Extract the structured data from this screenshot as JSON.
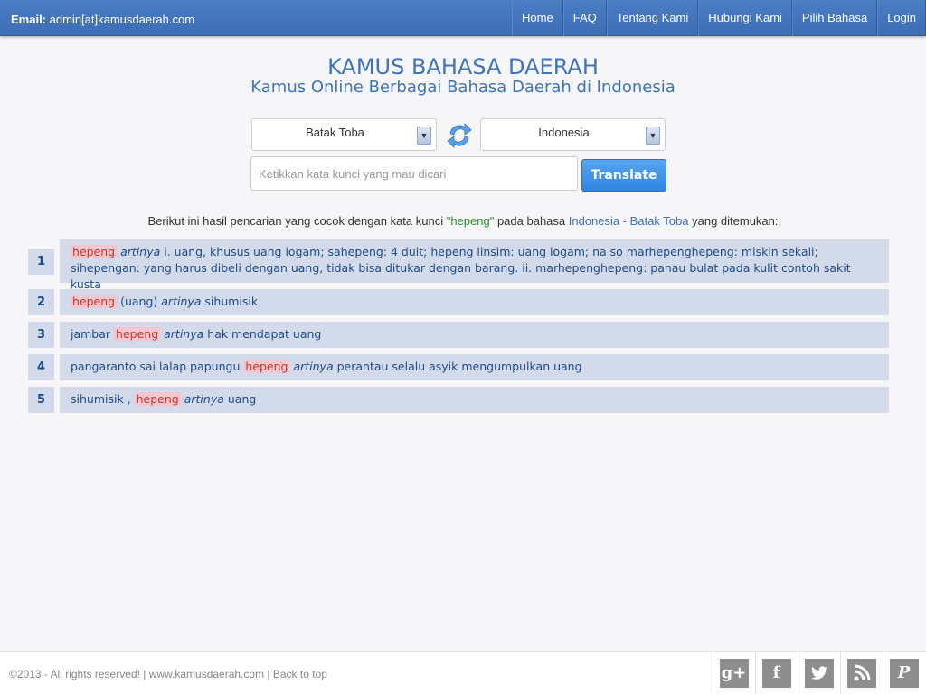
{
  "header": {
    "email_label": "Email:",
    "email_value": "admin[at]kamusdaerah.com",
    "nav": [
      {
        "label": "Home"
      },
      {
        "label": "FAQ"
      },
      {
        "label": "Tentang Kami"
      },
      {
        "label": "Hubungi Kami"
      },
      {
        "label": "Pilih Bahasa"
      },
      {
        "label": "Login"
      }
    ]
  },
  "main": {
    "title": "KAMUS BAHASA DAERAH",
    "subtitle": "Kamus Online Berbagai Bahasa Daerah di Indonesia",
    "from_language": "Batak Toba",
    "to_language": "Indonesia",
    "search_placeholder": "Ketikkan kata kunci yang mau dicari",
    "translate_label": "Translate",
    "intro": {
      "before": "Berikut ini hasil pencarian yang cocok dengan kata kunci ",
      "keyword": "\"hepeng\"",
      "middle": " pada bahasa ",
      "language_pair": "Indonesia - Batak Toba",
      "after": " yang ditemukan:"
    }
  },
  "results": [
    {
      "number": "1",
      "prefix": "",
      "keyword": "hepeng",
      "suffix": "",
      "artinya": "artinya",
      "meaning": "i. uang, khusus uang logam; sahepeng: 4 duit; hepeng linsim: uang logam; na so marhepenghepeng: miskin sekali; sihepengan: yang harus dibeli dengan uang, tidak bisa ditukar dengan barang. ii. marhepenghepeng: panau bulat pada kulit contoh sakit kusta"
    },
    {
      "number": "2",
      "prefix": "",
      "keyword": "hepeng",
      "suffix": " (uang)",
      "artinya": "artinya",
      "meaning": "sihumisik"
    },
    {
      "number": "3",
      "prefix": "jambar ",
      "keyword": "hepeng",
      "suffix": "",
      "artinya": "artinya",
      "meaning": "hak mendapat uang"
    },
    {
      "number": "4",
      "prefix": "pangaranto sai lalap papungu ",
      "keyword": "hepeng",
      "suffix": "",
      "artinya": "artinya",
      "meaning": "perantau selalu asyik mengumpulkan uang"
    },
    {
      "number": "5",
      "prefix": "sihumisik , ",
      "keyword": "hepeng",
      "suffix": "",
      "artinya": "artinya",
      "meaning": "uang"
    }
  ],
  "footer": {
    "copyright": "©2013 - All rights reserved! | www.kamusdaerah.com | ",
    "back_to_top": "Back to top",
    "social": [
      {
        "icon": "google-plus-icon",
        "glyph": "g+"
      },
      {
        "icon": "facebook-icon",
        "glyph": "f"
      },
      {
        "icon": "twitter-icon",
        "glyph": ""
      },
      {
        "icon": "rss-icon",
        "glyph": ""
      },
      {
        "icon": "paypal-icon",
        "glyph": "P"
      }
    ]
  },
  "colors": {
    "topbar": "#3c6db5",
    "title": "#3f74b7",
    "result_bg": "#d3dbea",
    "highlight_bg": "#f5c6cf",
    "keyword_green": "#2c8c2c",
    "button": "#2e86e0"
  }
}
